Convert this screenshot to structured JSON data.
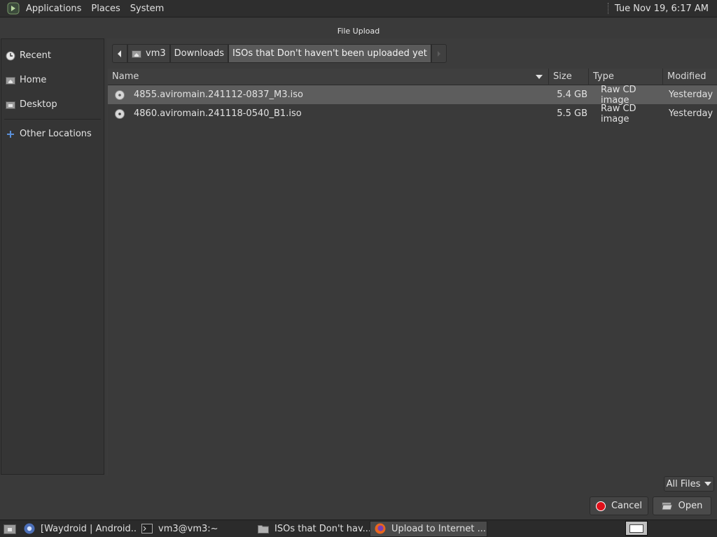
{
  "top_panel": {
    "menus": [
      "Applications",
      "Places",
      "System"
    ],
    "clock": "Tue Nov 19,  6:17 AM"
  },
  "dialog": {
    "title": "File Upload"
  },
  "sidebar": {
    "items": [
      {
        "label": "Recent",
        "icon": "clock-icon"
      },
      {
        "label": "Home",
        "icon": "home-folder-icon"
      },
      {
        "label": "Desktop",
        "icon": "desktop-folder-icon"
      }
    ],
    "other": {
      "label": "Other Locations",
      "icon": "plus-icon"
    }
  },
  "pathbar": {
    "crumbs": [
      "vm3",
      "Downloads",
      "ISOs that Don't haven't been uploaded yet"
    ]
  },
  "file_list": {
    "columns": {
      "name": "Name",
      "size": "Size",
      "type": "Type",
      "modified": "Modified"
    },
    "rows": [
      {
        "name": "4855.aviromain.241112-0837_M3.iso",
        "size": "5.4 GB",
        "type": "Raw CD image",
        "modified": "Yesterday",
        "selected": true
      },
      {
        "name": "4860.aviromain.241118-0540_B1.iso",
        "size": "5.5 GB",
        "type": "Raw CD image",
        "modified": "Yesterday",
        "selected": false
      }
    ]
  },
  "controls": {
    "filter": "All Files",
    "cancel": "Cancel",
    "open": "Open"
  },
  "taskbar": {
    "tasks": [
      {
        "label": "[Waydroid | Android...",
        "icon": "chromium-icon"
      },
      {
        "label": "vm3@vm3:~",
        "icon": "terminal-icon"
      },
      {
        "label": "ISOs that Don't hav...",
        "icon": "folder-icon"
      },
      {
        "label": "Upload to Internet ...",
        "icon": "firefox-icon",
        "active": true
      }
    ]
  },
  "colors": {
    "background": "#3a3a3a",
    "selected_row": "#5d5d5d",
    "panel": "#2e2e2e",
    "cancel_red": "#e0101a"
  }
}
